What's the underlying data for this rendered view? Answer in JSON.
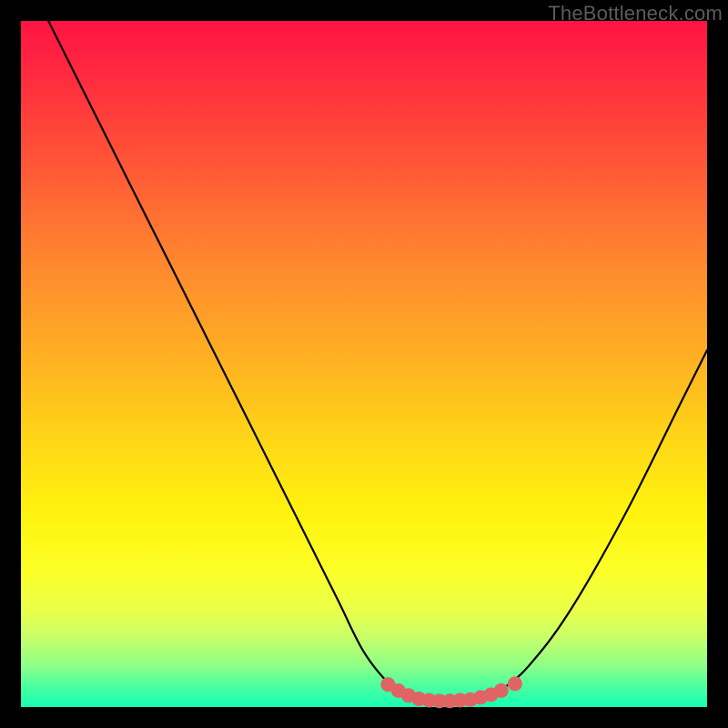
{
  "watermark": "TheBottleneck.com",
  "chart_data": {
    "type": "line",
    "title": "",
    "xlabel": "",
    "ylabel": "",
    "xlim": [
      0,
      100
    ],
    "ylim": [
      0,
      100
    ],
    "series": [
      {
        "name": "bottleneck-curve",
        "x": [
          4,
          10,
          16,
          22,
          28,
          34,
          40,
          46,
          50,
          54,
          56,
          58,
          60,
          62,
          64,
          66,
          68,
          70,
          74,
          80,
          88,
          96,
          100
        ],
        "y": [
          100,
          88,
          76,
          64,
          52,
          40,
          28,
          16,
          8,
          3,
          1.5,
          1,
          0.8,
          0.8,
          1,
          1.2,
          1.5,
          2.5,
          6,
          14,
          28,
          44,
          52
        ]
      }
    ],
    "highlight_band": {
      "name": "optimal-zone-dots",
      "x": [
        53.5,
        55,
        56.5,
        58,
        59.5,
        61,
        62.5,
        64,
        65.5,
        67,
        68.5,
        70,
        72
      ],
      "y": [
        3.3,
        2.4,
        1.7,
        1.2,
        1.0,
        0.9,
        0.9,
        1.0,
        1.1,
        1.4,
        1.8,
        2.4,
        3.4
      ]
    },
    "colors": {
      "curve": "#000000",
      "dots": "#e06464",
      "gradient_top": "#ff1344",
      "gradient_bottom": "#15ffb3"
    }
  }
}
